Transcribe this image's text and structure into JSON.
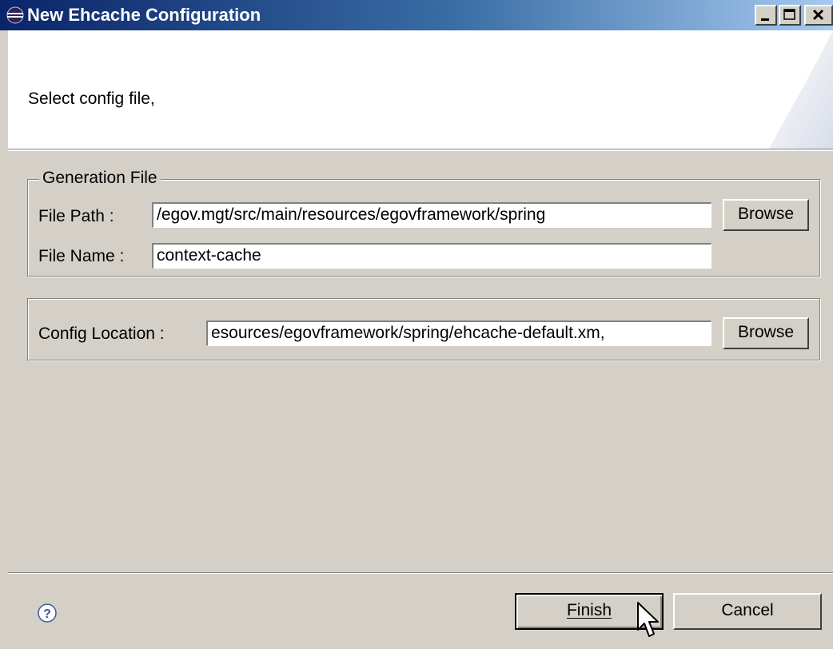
{
  "window": {
    "title": "New Ehcache Configuration",
    "icon": "eclipse-icon",
    "controls": [
      "minimize-icon",
      "maximize-icon",
      "close-icon"
    ]
  },
  "banner": {
    "message": "Select config file,"
  },
  "generation": {
    "legend": "Generation File",
    "file_path_label": "File Path :",
    "file_path_value": "/egov.mgt/src/main/resources/egovframework/spring",
    "file_name_label": "File Name :",
    "file_name_value": "context-cache",
    "browse_label": "Browse"
  },
  "config": {
    "location_label": "Config Location :",
    "location_value": "esources/egovframework/spring/ehcache-default.xm,",
    "browse_label": "Browse"
  },
  "footer": {
    "help_icon": "help-icon",
    "finish_label": "Finish",
    "cancel_label": "Cancel"
  },
  "colors": {
    "title_start": "#0a246a",
    "title_end": "#a6caf0",
    "face": "#d4d0c8"
  }
}
